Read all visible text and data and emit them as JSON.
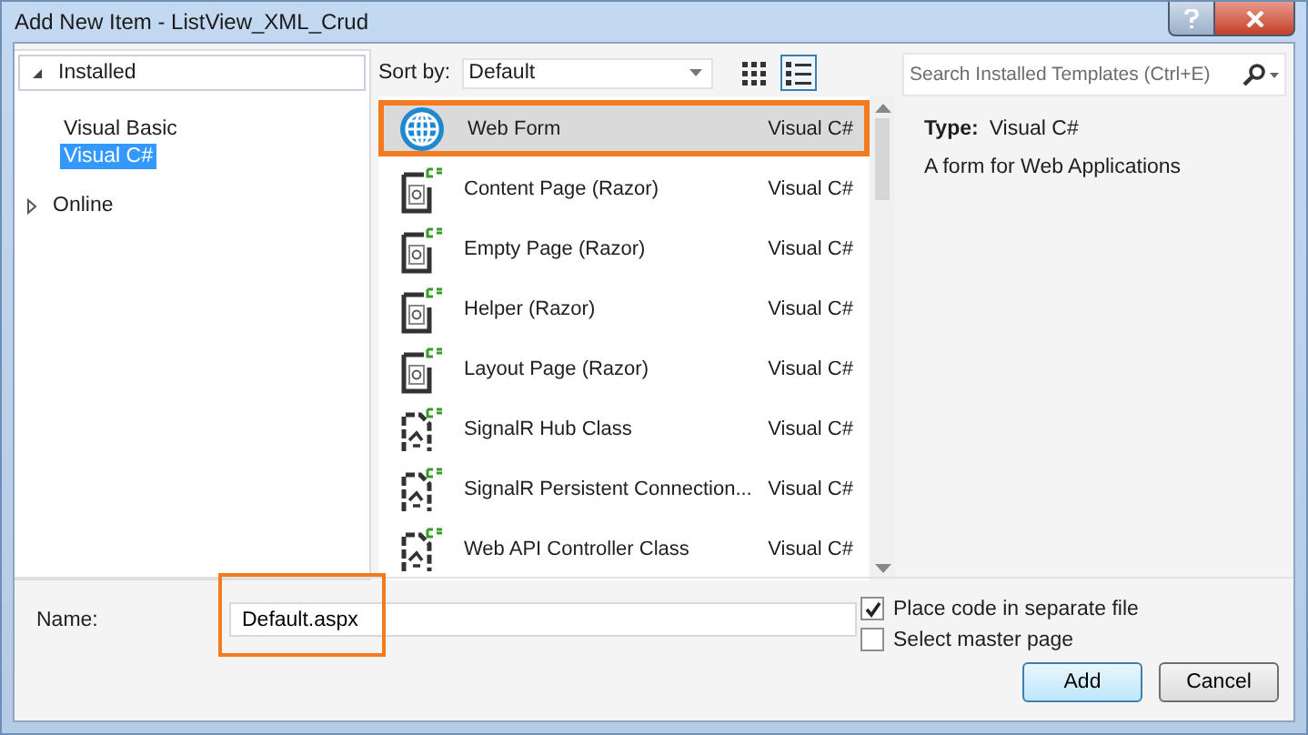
{
  "window": {
    "title": "Add New Item - ListView_XML_Crud"
  },
  "tree": [
    {
      "label": "Installed",
      "expanded": true,
      "children": [
        {
          "label": "Visual Basic",
          "selected": false
        },
        {
          "label": "Visual C#",
          "selected": true
        }
      ]
    },
    {
      "label": "Online",
      "expanded": false
    }
  ],
  "toolbar": {
    "sort_label": "Sort by:",
    "sort_value": "Default",
    "views": [
      {
        "kind": "grid",
        "selected": false
      },
      {
        "kind": "list",
        "selected": true
      }
    ]
  },
  "templates": [
    {
      "name": "Web Form",
      "language": "Visual C#",
      "kind": "globe",
      "selected": true
    },
    {
      "name": "Content Page (Razor)",
      "language": "Visual C#",
      "kind": "razor",
      "selected": false
    },
    {
      "name": "Empty Page (Razor)",
      "language": "Visual C#",
      "kind": "razor",
      "selected": false
    },
    {
      "name": "Helper (Razor)",
      "language": "Visual C#",
      "kind": "razor",
      "selected": false
    },
    {
      "name": "Layout Page (Razor)",
      "language": "Visual C#",
      "kind": "razor",
      "selected": false
    },
    {
      "name": "SignalR Hub Class",
      "language": "Visual C#",
      "kind": "signalr",
      "selected": false
    },
    {
      "name": "SignalR Persistent Connection...",
      "language": "Visual C#",
      "kind": "signalr",
      "selected": false
    },
    {
      "name": "Web API Controller Class",
      "language": "Visual C#",
      "kind": "signalr",
      "selected": false
    }
  ],
  "search": {
    "placeholder": "Search Installed Templates (Ctrl+E)"
  },
  "details": {
    "type_label": "Type:",
    "type_value": "Visual C#",
    "description": "A form for Web Applications"
  },
  "name_field": {
    "label": "Name:",
    "value": "Default.aspx",
    "highlighted": true
  },
  "options": [
    {
      "label": "Place code in separate file",
      "checked": true
    },
    {
      "label": "Select master page",
      "checked": false
    }
  ],
  "buttons": [
    {
      "label": "Add",
      "default": true
    },
    {
      "label": "Cancel",
      "default": false
    }
  ]
}
